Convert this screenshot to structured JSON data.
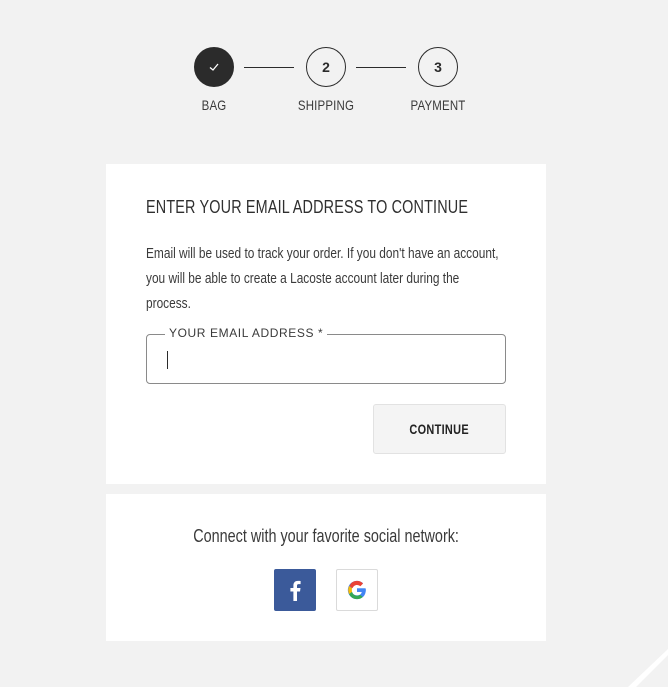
{
  "stepper": {
    "steps": [
      {
        "label": "BAG",
        "number": "",
        "state": "complete"
      },
      {
        "label": "SHIPPING",
        "number": "2",
        "state": "pending"
      },
      {
        "label": "PAYMENT",
        "number": "3",
        "state": "pending"
      }
    ]
  },
  "email_card": {
    "title": "ENTER YOUR EMAIL ADDRESS TO CONTINUE",
    "description": "Email will be used to track your order. If you don't have an account, you will be able to create a Lacoste account later during the process.",
    "field_label": "YOUR EMAIL ADDRESS *",
    "field_value": "",
    "continue_label": "CONTINUE"
  },
  "social_card": {
    "title": "Connect with your favorite social network:",
    "buttons": [
      {
        "icon": "facebook-icon",
        "color": "#3b5a9a"
      },
      {
        "icon": "google-icon",
        "color": "#ffffff"
      }
    ]
  },
  "colors": {
    "background": "#f2f2f2",
    "card": "#ffffff",
    "text": "#2b2b2b",
    "facebook": "#3b5a9a"
  }
}
